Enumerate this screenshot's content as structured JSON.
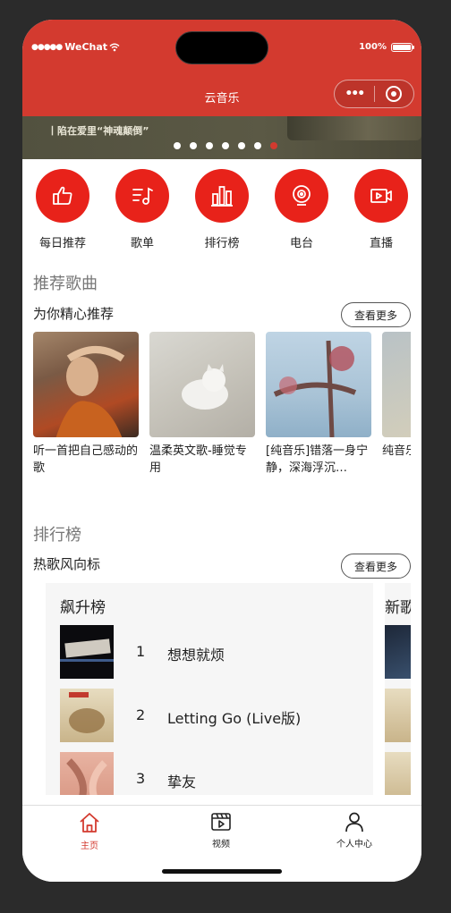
{
  "status": {
    "carrier": "WeChat",
    "battery": "100%"
  },
  "nav": {
    "title": "云音乐"
  },
  "banner": {
    "caption": "丨陷在爱里“神魂颠倒”",
    "page_count": 7,
    "active_page": 7
  },
  "quick_icons": [
    {
      "label": "每日推荐",
      "icon": "thumbs-up-icon"
    },
    {
      "label": "歌单",
      "icon": "playlist-icon"
    },
    {
      "label": "排行榜",
      "icon": "bar-chart-icon"
    },
    {
      "label": "电台",
      "icon": "radio-icon"
    },
    {
      "label": "直播",
      "icon": "video-play-icon"
    }
  ],
  "recommend": {
    "title": "推荐歌曲",
    "subtitle": "为你精心推荐",
    "more": "查看更多",
    "songs": [
      {
        "name": "听一首把自己感动的歌"
      },
      {
        "name": "温柔英文歌-睡觉专用"
      },
      {
        "name": "[纯音乐]错落一身宁静，深海浮沉…"
      },
      {
        "name": "纯音乐 压 学"
      }
    ]
  },
  "charts": {
    "title": "排行榜",
    "subtitle": "热歌风向标",
    "more": "查看更多",
    "lists": [
      {
        "title": "飙升榜",
        "items": [
          {
            "rank": "1",
            "name": "想想就烦"
          },
          {
            "rank": "2",
            "name": "Letting Go (Live版)"
          },
          {
            "rank": "3",
            "name": "挚友"
          }
        ]
      },
      {
        "title": "新歌",
        "items": []
      }
    ]
  },
  "tabbar": [
    {
      "label": "主页",
      "icon": "home-icon",
      "active": true
    },
    {
      "label": "视频",
      "icon": "video-icon",
      "active": false
    },
    {
      "label": "个人中心",
      "icon": "user-icon",
      "active": false
    }
  ],
  "colors": {
    "brand": "#d33a2f",
    "icon_red": "#e8221a"
  }
}
